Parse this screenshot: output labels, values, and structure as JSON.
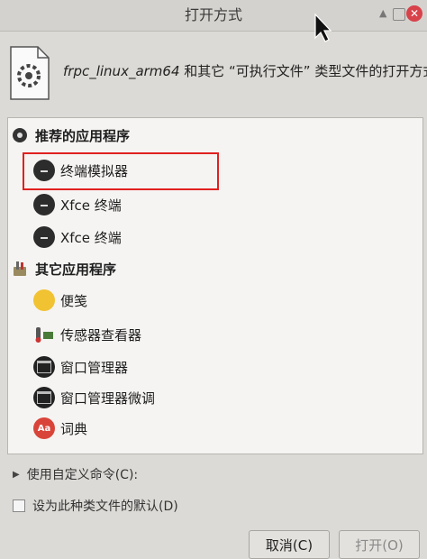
{
  "window": {
    "title": "打开方式"
  },
  "header": {
    "file_name": "frpc_linux_arm64",
    "description": " 和其它 “可执行文件” 类型文件的打开方式"
  },
  "recommended": {
    "heading": "推荐的应用程序",
    "items": [
      {
        "label": "终端模拟器",
        "icon": "terminal-icon"
      },
      {
        "label": "Xfce 终端",
        "icon": "terminal-icon"
      },
      {
        "label": "Xfce 终端",
        "icon": "terminal-icon"
      }
    ]
  },
  "other": {
    "heading": "其它应用程序",
    "items": [
      {
        "label": "便笺",
        "icon": "notes-icon"
      },
      {
        "label": "传感器查看器",
        "icon": "sensor-icon"
      },
      {
        "label": "窗口管理器",
        "icon": "window-manager-icon"
      },
      {
        "label": "窗口管理器微调",
        "icon": "window-manager-icon"
      },
      {
        "label": "词典",
        "icon": "dictionary-icon",
        "glyph": "Aa"
      }
    ]
  },
  "custom_command": {
    "label": "使用自定义命令(C):"
  },
  "set_default": {
    "label": "设为此种类文件的默认(D)",
    "checked": false
  },
  "buttons": {
    "cancel": "取消(C)",
    "open": "打开(O)"
  },
  "colors": {
    "highlight": "#e02020",
    "dictionary": "#d9443a",
    "notes": "#f1c232"
  }
}
